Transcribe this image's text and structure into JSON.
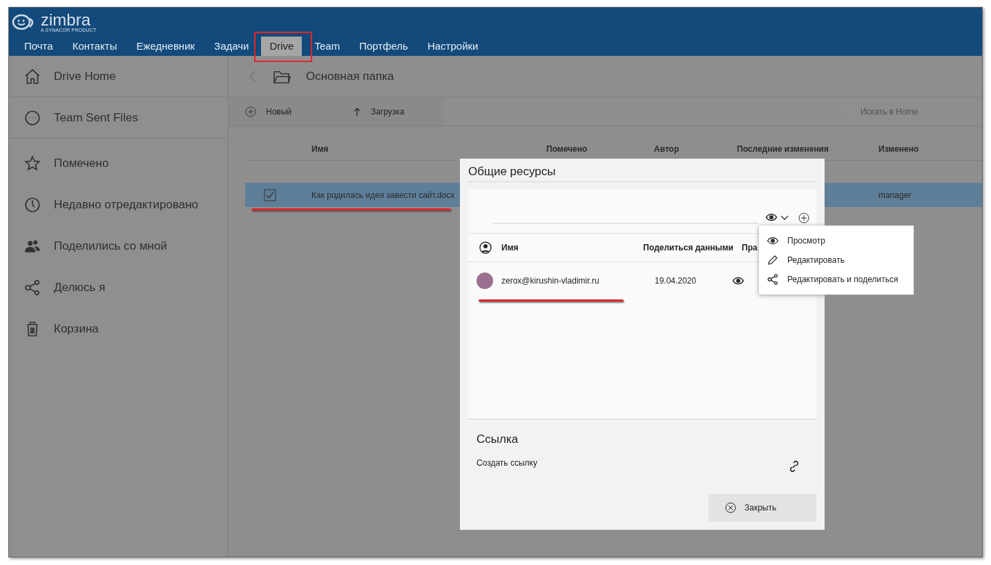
{
  "logo": {
    "name": "zimbra",
    "tagline": "A SYNACOR PRODUCT"
  },
  "nav_tabs": [
    {
      "label": "Почта",
      "selected": false
    },
    {
      "label": "Контакты",
      "selected": false
    },
    {
      "label": "Ежедневник",
      "selected": false
    },
    {
      "label": "Задачи",
      "selected": false
    },
    {
      "label": "Drive",
      "selected": true
    },
    {
      "label": "Team",
      "selected": false
    },
    {
      "label": "Портфель",
      "selected": false
    },
    {
      "label": "Настройки",
      "selected": false
    }
  ],
  "sidebar": {
    "items": [
      {
        "label": "Drive Home"
      },
      {
        "label": "Team Sent Files"
      },
      {
        "label": "Помечено"
      },
      {
        "label": "Недавно отредактировано"
      },
      {
        "label": "Поделились со мной"
      },
      {
        "label": "Делюсь я"
      },
      {
        "label": "Корзина"
      }
    ]
  },
  "breadcrumb": {
    "title": "Основная папка"
  },
  "toolbar": {
    "buttons": [
      "Новый",
      "Загрузка"
    ],
    "search": {
      "placeholder": "Искать в Home"
    }
  },
  "table": {
    "columns": [
      "Имя",
      "Помечено",
      "Автор",
      "Последние изменения",
      "Изменено"
    ],
    "rows": [
      {
        "checked": true,
        "selected": true,
        "name": "Как родилась идея завести сайт.docx",
        "modified_by": "manager"
      }
    ]
  },
  "dialog": {
    "title": "Общие ресурсы",
    "share_table": {
      "columns": [
        "Имя",
        "Поделиться данными",
        "Пра"
      ],
      "rows": [
        {
          "email": "zerox@kirushin-vladimir.ru",
          "date": "19.04.2020"
        }
      ]
    },
    "permission_menu": {
      "items": [
        "Просмотр",
        "Редактировать",
        "Редактировать и поделиться"
      ]
    },
    "link_section": {
      "title": "Ссылка",
      "create_label": "Создать ссылку"
    },
    "close_button": "Закрыть"
  }
}
